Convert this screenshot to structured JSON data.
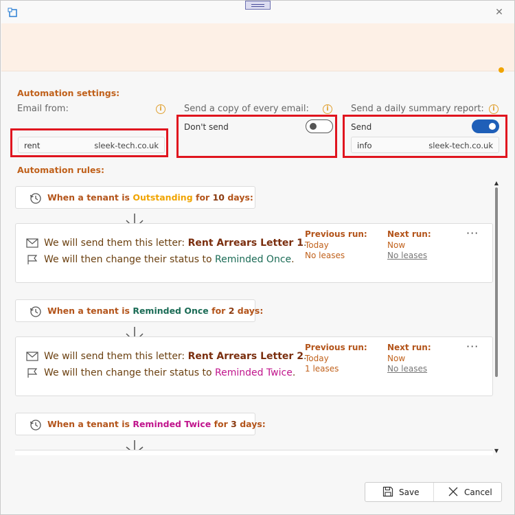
{
  "settings": {
    "title": "Automation settings:",
    "email_from": {
      "label": "Email from:",
      "value": "rent",
      "domain": "sleek-tech.co.uk"
    },
    "copy_email": {
      "label": "Send a copy of every email:",
      "toggle_label": "Don't send",
      "toggle_on": false
    },
    "summary_report": {
      "label": "Send a daily summary report:",
      "toggle_label": "Send",
      "toggle_on": true,
      "value": "info",
      "domain": "sleek-tech.co.uk"
    }
  },
  "rules_title": "Automation rules:",
  "rules": [
    {
      "trigger": {
        "prefix": "When a tenant is",
        "status": "Outstanding",
        "mid": "for",
        "days": "10",
        "suffix": "days:"
      },
      "letter_prefix": "We will send them this letter:",
      "letter": "Rent Arrears Letter 1",
      "status_prefix": "We will then change their status to",
      "new_status": "Reminded Once",
      "previous_run": {
        "label": "Previous run:",
        "when": "Today",
        "leases": "No leases"
      },
      "next_run": {
        "label": "Next run:",
        "when": "Now",
        "leases": "No leases"
      }
    },
    {
      "trigger": {
        "prefix": "When a tenant is",
        "status": "Reminded Once",
        "mid": "for",
        "days": "2",
        "suffix": "days:"
      },
      "letter_prefix": "We will send them this letter:",
      "letter": "Rent Arrears Letter 2",
      "status_prefix": "We will then change their status to",
      "new_status": "Reminded Twice",
      "previous_run": {
        "label": "Previous run:",
        "when": "Today",
        "leases": "1 leases"
      },
      "next_run": {
        "label": "Next run:",
        "when": "Now",
        "leases": "No leases"
      }
    },
    {
      "trigger": {
        "prefix": "When a tenant is",
        "status": "Reminded Twice",
        "mid": "for",
        "days": "3",
        "suffix": "days:"
      }
    }
  ],
  "footer": {
    "save": "Save",
    "cancel": "Cancel"
  },
  "icons": {
    "close": "close-icon",
    "info": "info-icon",
    "clock": "history-clock-icon",
    "mail": "mail-icon",
    "flag": "flag-icon",
    "save": "save-disk-icon",
    "cancel": "x-icon"
  },
  "colors": {
    "accent": "#c0611b",
    "toggle_on": "#1f5fb8",
    "outstanding": "#f0a400",
    "reminded_once": "#1a6b55",
    "reminded_twice": "#c0148c",
    "highlight_box": "#e0141e"
  }
}
